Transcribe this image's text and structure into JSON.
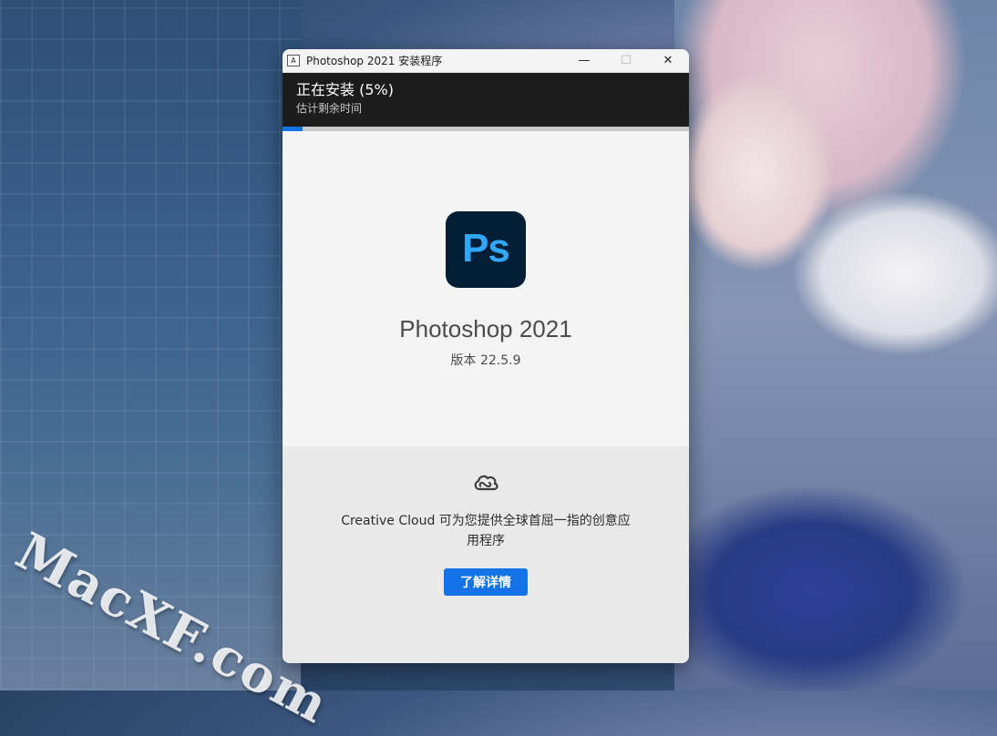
{
  "desktop": {
    "watermark": "MacXF.com"
  },
  "window": {
    "title": "Photoshop 2021 安装程序",
    "app_icon_glyph": "A",
    "controls": {
      "minimize": "—",
      "maximize": "☐",
      "close": "✕"
    }
  },
  "status": {
    "title": "正在安装 (5%)",
    "subtitle": "估计剩余时间",
    "progress_percent": 5
  },
  "product": {
    "logo_text": "Ps",
    "name": "Photoshop 2021",
    "version": "版本 22.5.9"
  },
  "promo": {
    "icon": "creative-cloud-icon",
    "text": "Creative Cloud 可为您提供全球首屈一指的创意应用程序",
    "button_label": "了解详情"
  },
  "colors": {
    "accent": "#1473e6",
    "logo_bg": "#001e36",
    "logo_fg": "#31a8ff",
    "status_band": "#1c1c1c"
  }
}
